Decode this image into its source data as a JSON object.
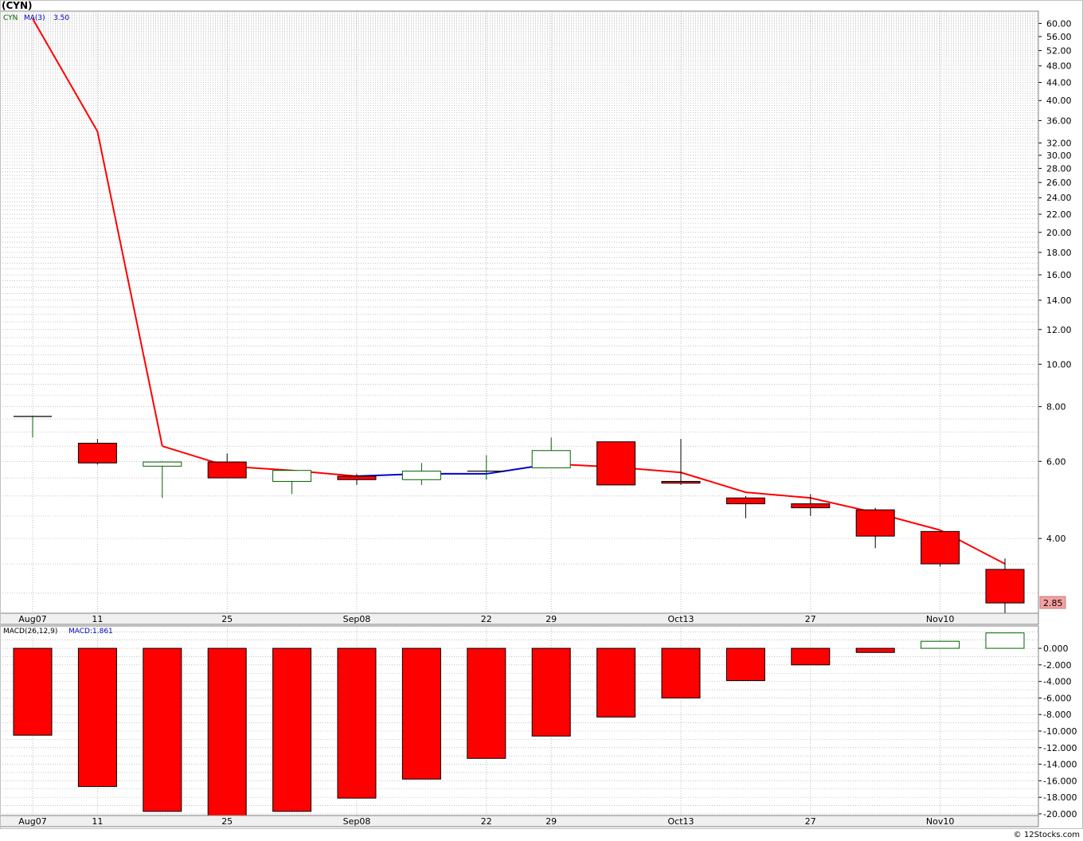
{
  "title": "(CYN)",
  "colors": {
    "down": "#ff0000",
    "up_outline": "#006400",
    "ma_line_down": "#ff0000",
    "ma_line_up": "#0000cc",
    "grid": "#a0a0a0",
    "panel_border": "#808080",
    "axis_bg": "#f0f0f0",
    "last_price_bg": "#f4a0a0"
  },
  "price_legend": {
    "symbol": "CYN",
    "ma_label": "MA(3)",
    "ma_value": "3.50"
  },
  "macd_legend": {
    "label": "MACD(26,12,9)",
    "value_label": "MACD:1.861"
  },
  "last_price_label": "2.85",
  "footer": "© 12Stocks.com",
  "x_tick_labels": [
    {
      "i": 0,
      "label": "Aug07"
    },
    {
      "i": 1,
      "label": "11"
    },
    {
      "i": 3,
      "label": "25"
    },
    {
      "i": 5,
      "label": "Sep08"
    },
    {
      "i": 7,
      "label": "22"
    },
    {
      "i": 8,
      "label": "29"
    },
    {
      "i": 10,
      "label": "Oct13"
    },
    {
      "i": 12,
      "label": "27"
    },
    {
      "i": 14,
      "label": "Nov10"
    }
  ],
  "chart_data": [
    {
      "type": "candlestick",
      "panel": "price",
      "y_scale": "log",
      "ylim": [
        2.7,
        64
      ],
      "y_ticks": [
        60,
        56,
        52,
        48,
        44,
        40,
        36,
        32,
        30,
        28,
        26,
        24,
        22,
        20,
        18,
        16,
        14,
        12,
        10,
        8,
        6,
        4
      ],
      "y_tick_labels": [
        "60.00",
        "56.00",
        "52.00",
        "48.00",
        "44.00",
        "40.00",
        "36.00",
        "32.00",
        "30.00",
        "28.00",
        "26.00",
        "24.00",
        "22.00",
        "20.00",
        "18.00",
        "16.00",
        "14.00",
        "12.00",
        "10.00",
        "8.00",
        "6.00",
        "4.00"
      ],
      "candles": [
        {
          "o": 7.6,
          "h": 7.6,
          "l": 6.8,
          "c": 7.6
        },
        {
          "o": 6.6,
          "h": 6.75,
          "l": 5.9,
          "c": 5.95
        },
        {
          "o": 5.85,
          "h": 6.0,
          "l": 4.95,
          "c": 5.98
        },
        {
          "o": 5.98,
          "h": 6.25,
          "l": 5.5,
          "c": 5.5
        },
        {
          "o": 5.4,
          "h": 5.7,
          "l": 5.05,
          "c": 5.72
        },
        {
          "o": 5.55,
          "h": 5.62,
          "l": 5.3,
          "c": 5.45
        },
        {
          "o": 5.45,
          "h": 5.95,
          "l": 5.3,
          "c": 5.7
        },
        {
          "o": 5.7,
          "h": 6.2,
          "l": 5.45,
          "c": 5.7
        },
        {
          "o": 5.8,
          "h": 6.8,
          "l": 5.8,
          "c": 6.35
        },
        {
          "o": 6.65,
          "h": 6.65,
          "l": 5.3,
          "c": 5.3
        },
        {
          "o": 5.4,
          "h": 6.75,
          "l": 5.3,
          "c": 5.35
        },
        {
          "o": 4.95,
          "h": 5.0,
          "l": 4.45,
          "c": 4.8
        },
        {
          "o": 4.8,
          "h": 5.05,
          "l": 4.5,
          "c": 4.7
        },
        {
          "o": 4.65,
          "h": 4.7,
          "l": 3.8,
          "c": 4.05
        },
        {
          "o": 4.15,
          "h": 4.15,
          "l": 3.45,
          "c": 3.5
        },
        {
          "o": 3.4,
          "h": 3.6,
          "l": 2.7,
          "c": 2.85
        }
      ],
      "ma_line": {
        "name": "MA(3)",
        "values": [
          61.5,
          34.0,
          6.5,
          5.85,
          5.72,
          5.55,
          5.62,
          5.62,
          5.92,
          5.82,
          5.66,
          5.1,
          4.95,
          4.58,
          4.18,
          3.5
        ]
      }
    },
    {
      "type": "bar",
      "panel": "macd",
      "name": "MACD(26,12,9)",
      "ylim": [
        -20.2,
        2.7
      ],
      "y_ticks": [
        0,
        -2,
        -4,
        -6,
        -8,
        -10,
        -12,
        -14,
        -16,
        -18,
        -20
      ],
      "y_tick_labels": [
        "0.000",
        "-2.000",
        "-4.000",
        "-6.000",
        "-8.000",
        "-10.000",
        "-12.000",
        "-14.000",
        "-16.000",
        "-18.000",
        "-20.000"
      ],
      "values": [
        -10.5,
        -16.7,
        -19.7,
        -20.2,
        -19.7,
        -18.1,
        -15.8,
        -13.3,
        -10.6,
        -8.3,
        -6.0,
        -3.9,
        -2.0,
        -0.5,
        0.85,
        1.861
      ]
    }
  ]
}
